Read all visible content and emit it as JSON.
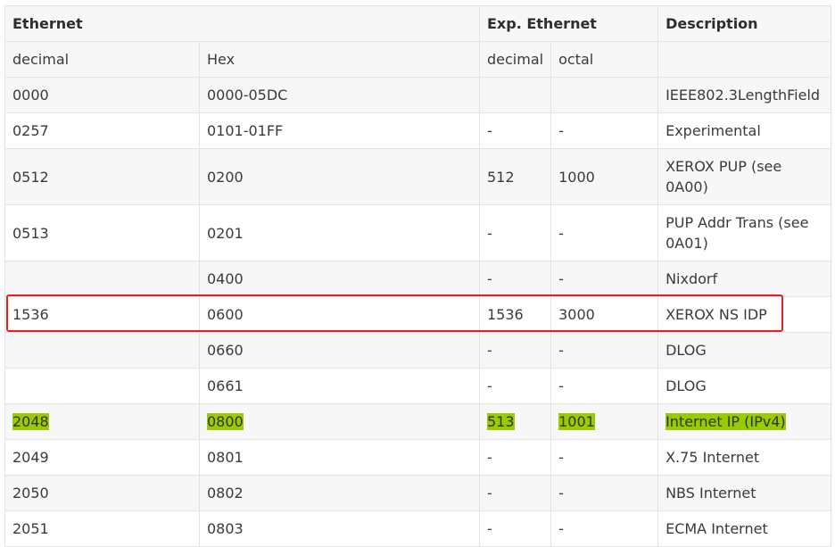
{
  "header": {
    "ethernet": "Ethernet",
    "exp_ethernet": "Exp. Ethernet",
    "description": "Description"
  },
  "subheader": {
    "decimal": "decimal",
    "hex": "Hex",
    "exp_decimal": "decimal",
    "exp_octal": "octal",
    "desc": ""
  },
  "rows": [
    {
      "decimal": "0000",
      "hex": "0000-05DC",
      "exp_decimal": "",
      "exp_octal": "",
      "description": "IEEE802.3LengthField"
    },
    {
      "decimal": "0257",
      "hex": "0101-01FF",
      "exp_decimal": "-",
      "exp_octal": "-",
      "description": "Experimental"
    },
    {
      "decimal": "0512",
      "hex": "0200",
      "exp_decimal": "512",
      "exp_octal": "1000",
      "description": "XEROX PUP (see 0A00)"
    },
    {
      "decimal": "0513",
      "hex": "0201",
      "exp_decimal": "-",
      "exp_octal": "-",
      "description": "PUP Addr Trans (see 0A01)"
    },
    {
      "decimal": "",
      "hex": "0400",
      "exp_decimal": "-",
      "exp_octal": "-",
      "description": "Nixdorf"
    },
    {
      "decimal": "1536",
      "hex": "0600",
      "exp_decimal": "1536",
      "exp_octal": "3000",
      "description": "XEROX NS IDP"
    },
    {
      "decimal": "",
      "hex": "0660",
      "exp_decimal": "-",
      "exp_octal": "-",
      "description": "DLOG"
    },
    {
      "decimal": "",
      "hex": "0661",
      "exp_decimal": "-",
      "exp_octal": "-",
      "description": "DLOG"
    },
    {
      "decimal": "2048",
      "hex": "0800",
      "exp_decimal": "513",
      "exp_octal": "1001",
      "description": "Internet IP (IPv4)"
    },
    {
      "decimal": "2049",
      "hex": "0801",
      "exp_decimal": "-",
      "exp_octal": "-",
      "description": "X.75 Internet"
    },
    {
      "decimal": "2050",
      "hex": "0802",
      "exp_decimal": "-",
      "exp_octal": "-",
      "description": "NBS Internet"
    },
    {
      "decimal": "2051",
      "hex": "0803",
      "exp_decimal": "-",
      "exp_octal": "-",
      "description": "ECMA Internet"
    }
  ],
  "annotations": {
    "red_box_row": "1536",
    "highlight_row": "2048",
    "highlight_color": "#99cc00",
    "red_box_color": "#e8201b"
  }
}
